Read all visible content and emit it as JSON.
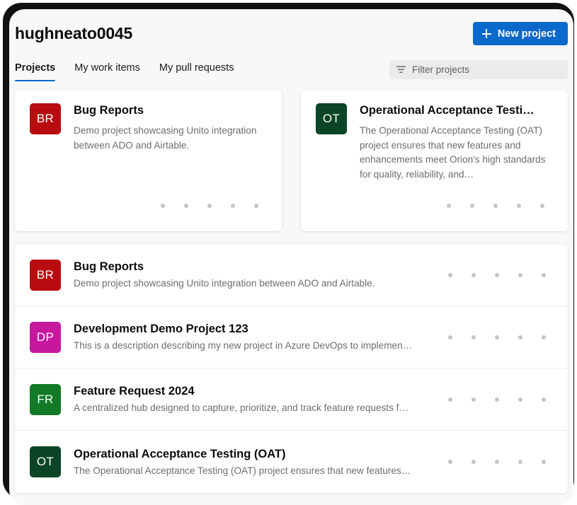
{
  "header": {
    "title": "hughneato0045",
    "new_project_label": "New project",
    "plus_icon": "plus-icon",
    "accent_color": "#0a69ca"
  },
  "tabs": [
    {
      "label": "Projects",
      "active": true
    },
    {
      "label": "My work items",
      "active": false
    },
    {
      "label": "My pull requests",
      "active": false
    }
  ],
  "filter": {
    "placeholder": "Filter projects",
    "value": "",
    "icon": "filter-icon"
  },
  "featured_cards": [
    {
      "initials": "BR",
      "color": "#b80c10",
      "title": "Bug Reports",
      "description": "Demo project showcasing Unito integration between ADO and Airtable.",
      "dots": 5
    },
    {
      "initials": "OT",
      "color": "#0b4426",
      "title": "Operational Acceptance Testi…",
      "description": "The Operational Acceptance Testing (OAT) project ensures that new features and enhancements meet Orion's high standards for quality, reliability, and…",
      "dots": 5
    }
  ],
  "project_rows": [
    {
      "initials": "BR",
      "color": "#b80c10",
      "title": "Bug Reports",
      "description": "Demo project showcasing Unito integration between ADO and Airtable.",
      "dots": 5
    },
    {
      "initials": "DP",
      "color": "#c5189e",
      "title": "Development Demo Project 123",
      "description": "This is a description describing my new project in Azure DevOps to implemen…",
      "dots": 5
    },
    {
      "initials": "FR",
      "color": "#117a26",
      "title": "Feature Request 2024",
      "description": "A centralized hub designed to capture, prioritize, and track feature requests f…",
      "dots": 5
    },
    {
      "initials": "OT",
      "color": "#0b4426",
      "title": "Operational Acceptance Testing (OAT)",
      "description": "The Operational Acceptance Testing (OAT) project ensures that new features…",
      "dots": 5
    }
  ]
}
